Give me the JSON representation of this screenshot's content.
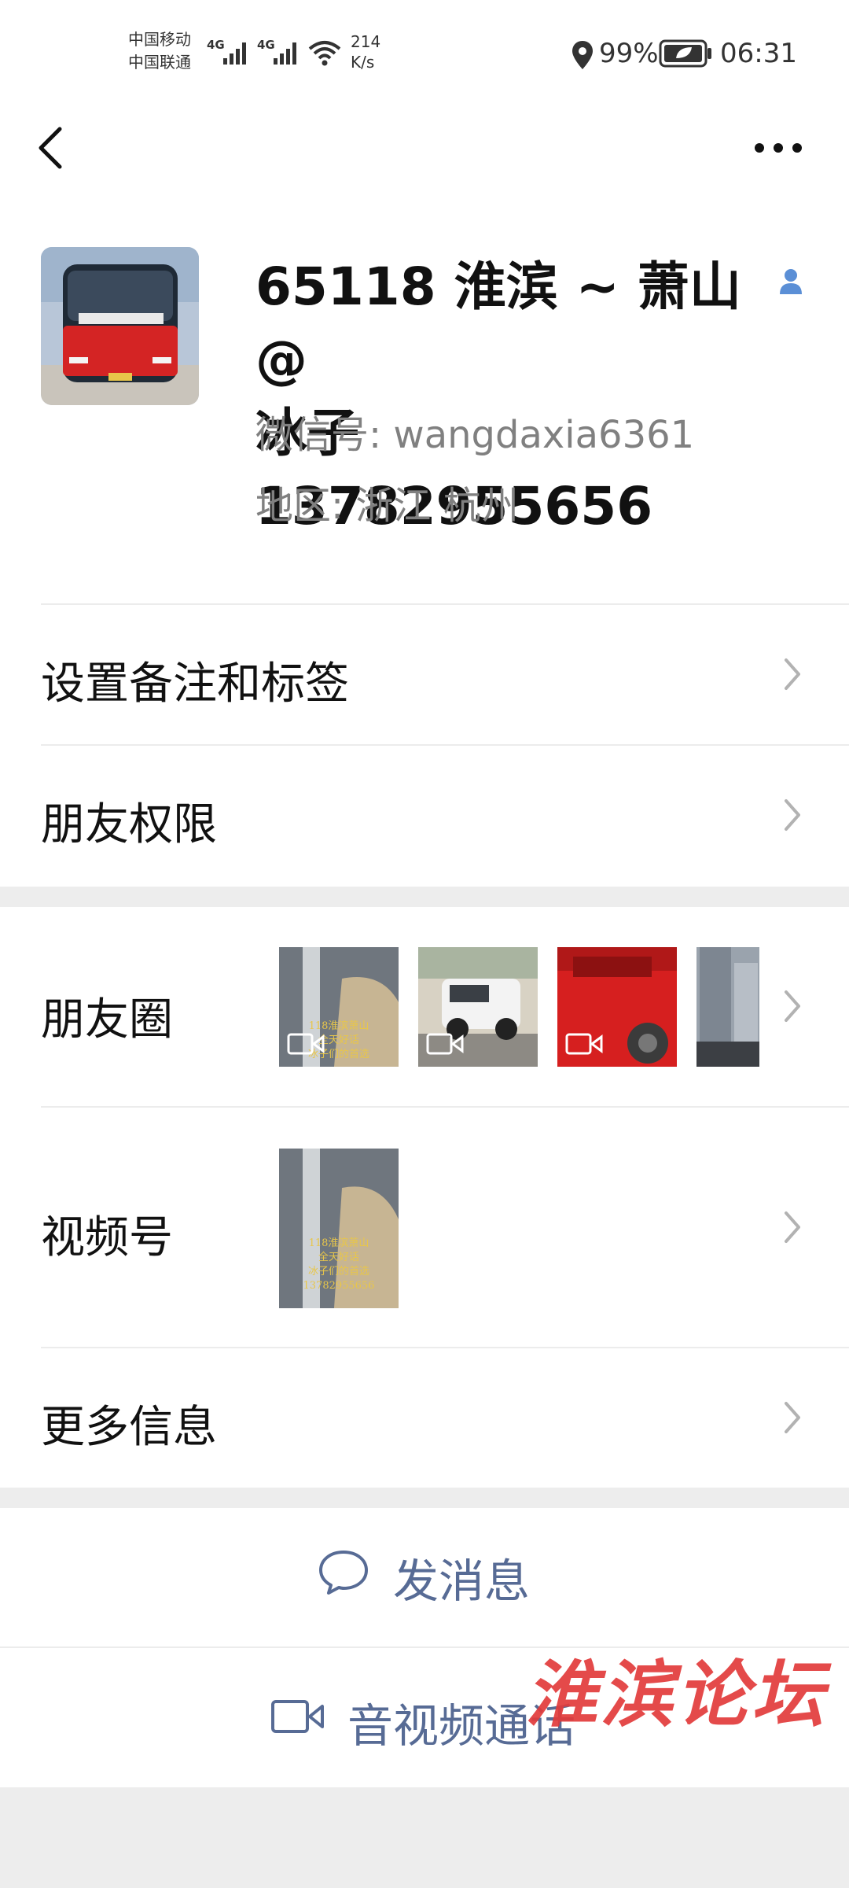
{
  "status_bar": {
    "carrier1": "中国移动",
    "carrier2": "中国联通",
    "net1": "4G",
    "net2": "4G",
    "speed_value": "214",
    "speed_unit": "K/s",
    "battery": "99%",
    "time": "06:31"
  },
  "nav": {
    "back_icon": "chevron-left-icon",
    "more_icon": "ellipsis-icon"
  },
  "profile": {
    "name_line1": "65118 淮滨 ~ 萧山@",
    "name_line2": "冰子 13782955656",
    "wechat_id": "微信号:  wangdaxia6361",
    "region": "地区:  浙江  杭州"
  },
  "menu": {
    "remark": "设置备注和标签",
    "permission": "朋友权限",
    "moments": "朋友圈",
    "channels": "视频号",
    "more_info": "更多信息"
  },
  "thumb_text": {
    "line1": "118淮滨萧山",
    "line2": "全天好话",
    "line3": "冰子们的首选",
    "line4": "13782955656"
  },
  "actions": {
    "send_message": "发消息",
    "av_call": "音视频通话"
  },
  "watermark": "淮滨论坛",
  "colors": {
    "link": "#576b95",
    "watermark": "#e23b3b",
    "section_gap": "#ededed"
  }
}
